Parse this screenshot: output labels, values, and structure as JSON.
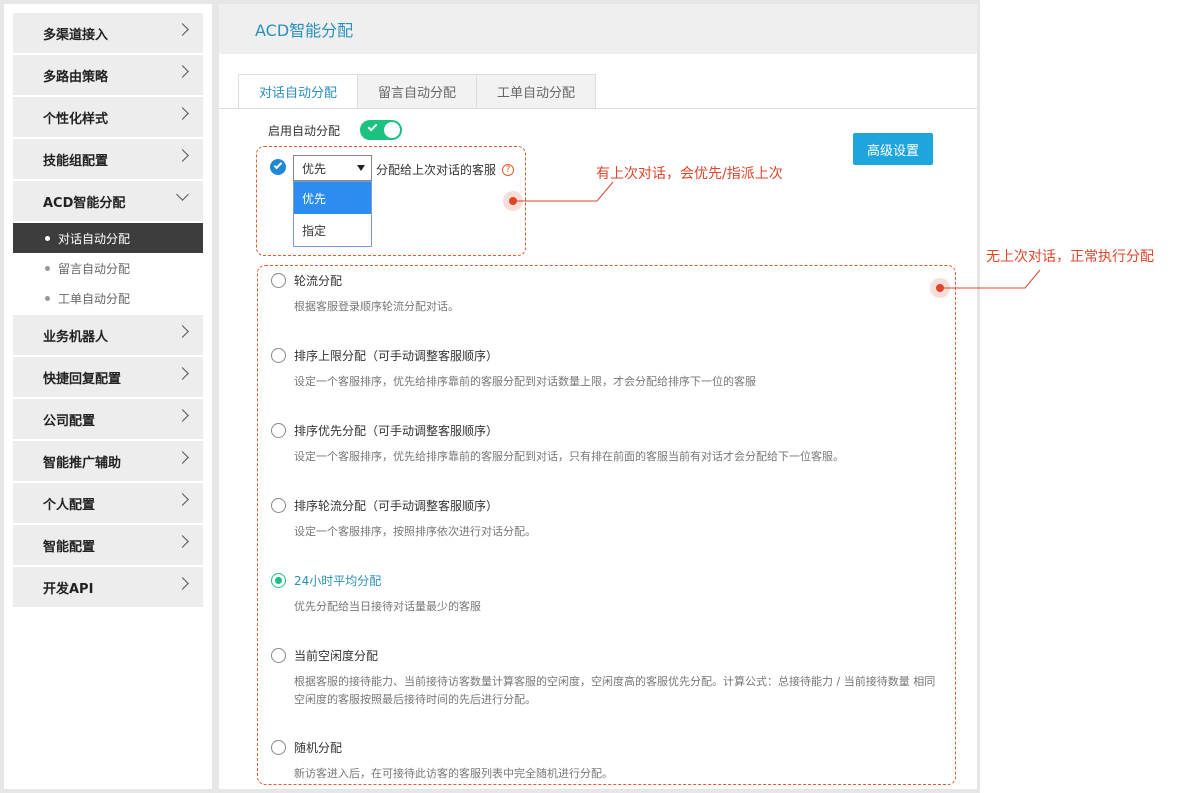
{
  "sidebar": {
    "items": [
      {
        "label": "多渠道接入"
      },
      {
        "label": "多路由策略"
      },
      {
        "label": "个性化样式"
      },
      {
        "label": "技能组配置"
      },
      {
        "label": "ACD智能分配",
        "expanded": true
      },
      {
        "label": "业务机器人"
      },
      {
        "label": "快捷回复配置"
      },
      {
        "label": "公司配置"
      },
      {
        "label": "智能推广辅助"
      },
      {
        "label": "个人配置"
      },
      {
        "label": "智能配置"
      },
      {
        "label": "开发API"
      }
    ],
    "subitems": [
      {
        "label": "对话自动分配",
        "active": true
      },
      {
        "label": "留言自动分配"
      },
      {
        "label": "工单自动分配"
      }
    ]
  },
  "header": {
    "title": "ACD智能分配"
  },
  "tabs": [
    {
      "label": "对话自动分配",
      "active": true
    },
    {
      "label": "留言自动分配"
    },
    {
      "label": "工单自动分配"
    }
  ],
  "enable": {
    "label": "启用自动分配",
    "on": true
  },
  "advanced_button": "高级设置",
  "last_agent": {
    "checked": true,
    "select_value": "优先",
    "suffix": "分配给上次对话的客服",
    "help": "?",
    "options": [
      "优先",
      "指定"
    ]
  },
  "strategies": [
    {
      "title": "轮流分配",
      "desc": "根据客服登录顺序轮流分配对话。",
      "selected": false
    },
    {
      "title": "排序上限分配（可手动调整客服顺序）",
      "desc": "设定一个客服排序，优先给排序靠前的客服分配到对话数量上限，才会分配给排序下一位的客服",
      "selected": false
    },
    {
      "title": "排序优先分配（可手动调整客服顺序）",
      "desc": "设定一个客服排序，优先给排序靠前的客服分配到对话，只有排在前面的客服当前有对话才会分配给下一位客服。",
      "selected": false
    },
    {
      "title": "排序轮流分配（可手动调整客服顺序）",
      "desc": "设定一个客服排序，按照排序依次进行对话分配。",
      "selected": false
    },
    {
      "title": "24小时平均分配",
      "desc": "优先分配给当日接待对话量最少的客服",
      "selected": true
    },
    {
      "title": "当前空闲度分配",
      "desc": "根据客服的接待能力、当前接待访客数量计算客服的空闲度，空闲度高的客服优先分配。计算公式：总接待能力 / 当前接待数量 相同空闲度的客服按照最后接待时间的先后进行分配。",
      "selected": false
    },
    {
      "title": "随机分配",
      "desc": "新访客进入后，在可接待此访客的客服列表中完全随机进行分配。",
      "selected": false
    }
  ],
  "annotations": {
    "top": "有上次对话，会优先/指派上次",
    "right": "无上次对话，正常执行分配"
  },
  "colors": {
    "accent": "#2a8fbd",
    "toggle": "#19c27d",
    "button": "#1ea5dd",
    "annotation": "#e0452a"
  }
}
